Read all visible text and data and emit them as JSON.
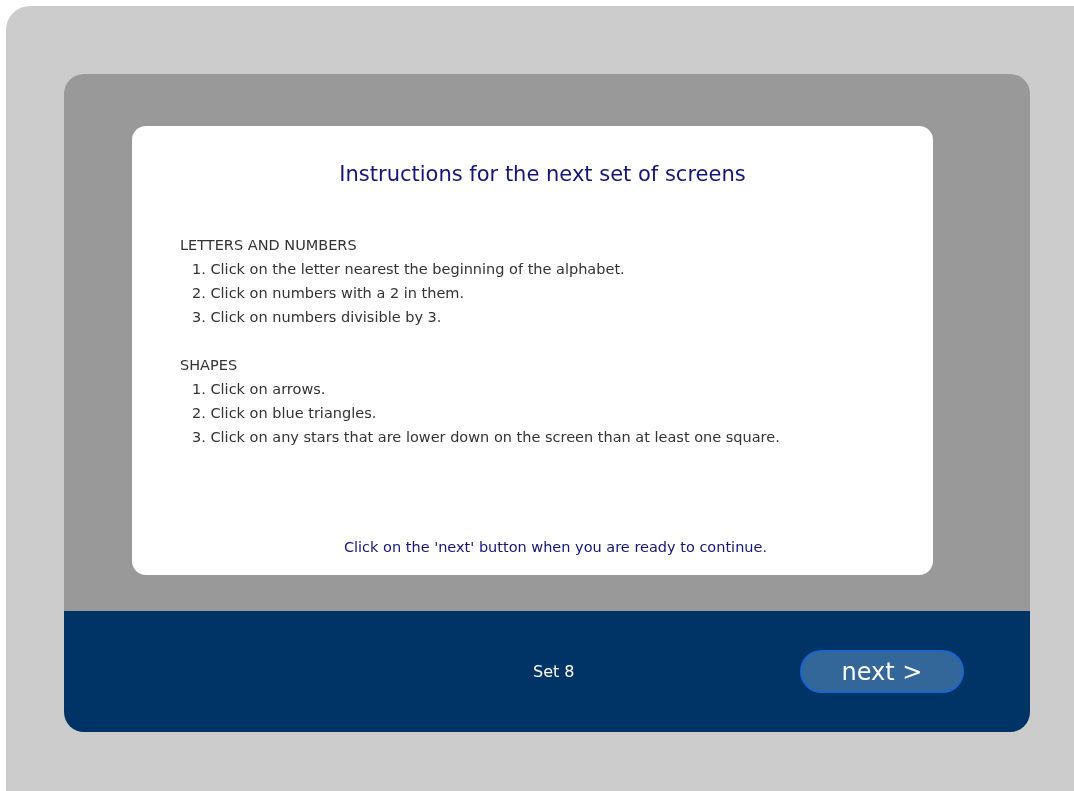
{
  "title": "Instructions for the next set of screens",
  "sections": [
    {
      "heading": "LETTERS AND NUMBERS",
      "items": [
        "1. Click on the letter nearest the beginning of the alphabet.",
        "2. Click on numbers with a 2 in them.",
        "3. Click on numbers divisible by 3."
      ]
    },
    {
      "heading": "SHAPES",
      "items": [
        "1. Click on arrows.",
        "2. Click on blue triangles.",
        "3. Click on any stars that are lower down on the screen than at least one square."
      ]
    }
  ],
  "footer_note": "Click on the 'next' button when you are ready to continue.",
  "set_label": "Set 8",
  "next_button": "next >"
}
